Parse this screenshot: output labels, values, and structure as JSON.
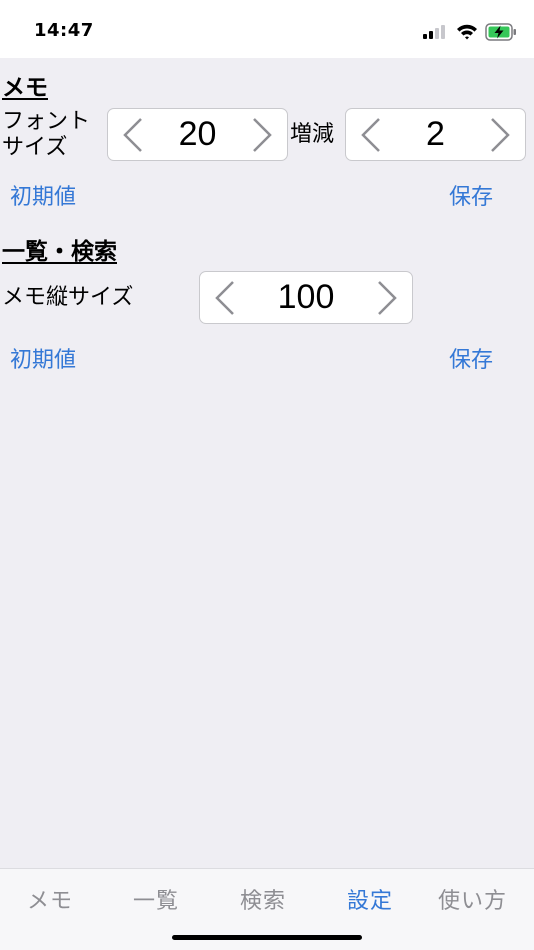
{
  "status": {
    "time": "14:47"
  },
  "memo": {
    "title": "メモ",
    "font_size_label": "フォント\nサイズ",
    "font_size_value": "20",
    "step_label": "増減",
    "step_value": "2",
    "reset_label": "初期値",
    "save_label": "保存"
  },
  "list_search": {
    "title": "一覧・検索",
    "height_label": "メモ縦サイズ",
    "height_value": "100",
    "reset_label": "初期値",
    "save_label": "保存"
  },
  "tabs": [
    {
      "label": "メモ"
    },
    {
      "label": "一覧"
    },
    {
      "label": "検索"
    },
    {
      "label": "設定"
    },
    {
      "label": "使い方"
    }
  ],
  "colors": {
    "accent": "#3478d6",
    "background": "#efeef3",
    "tab_inactive": "#8e8e93"
  }
}
